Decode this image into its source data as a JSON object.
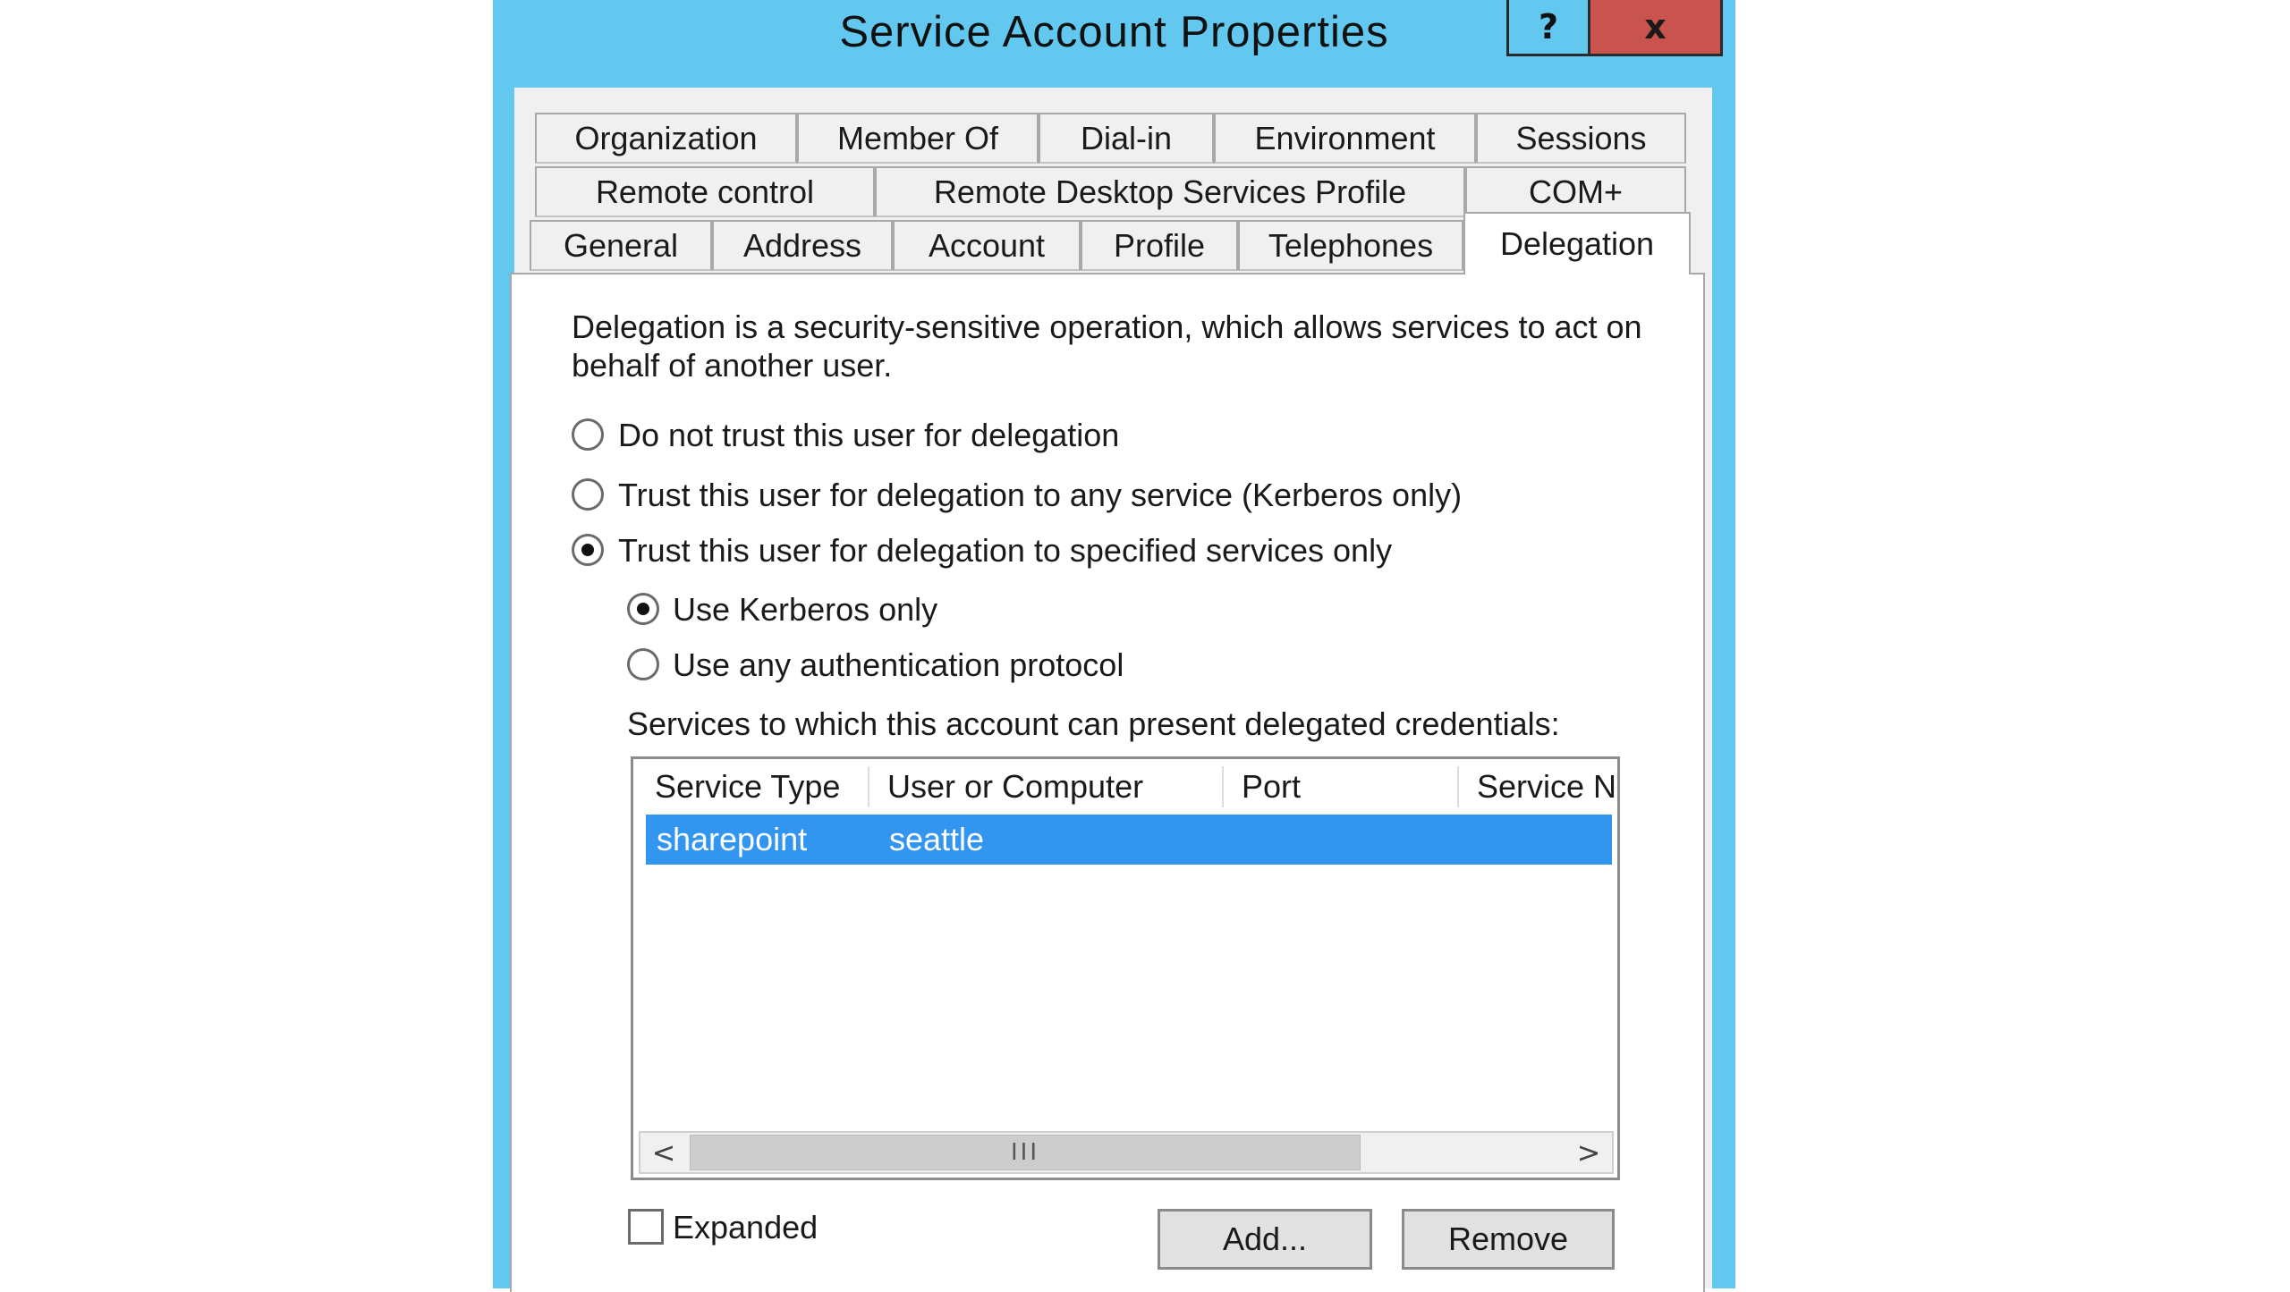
{
  "window": {
    "title": "Service Account Properties",
    "help_label": "?",
    "close_label": "x"
  },
  "tabs": {
    "row1": [
      "Organization",
      "Member Of",
      "Dial-in",
      "Environment",
      "Sessions"
    ],
    "row2": [
      "Remote control",
      "Remote Desktop Services Profile",
      "COM+"
    ],
    "row3": [
      "General",
      "Address",
      "Account",
      "Profile",
      "Telephones",
      "Delegation"
    ],
    "active": "Delegation"
  },
  "delegation": {
    "description_line1": "Delegation is a security-sensitive operation, which allows services to act on",
    "description_line2": "behalf of another user.",
    "options": [
      {
        "label": "Do not trust this user for delegation",
        "checked": false
      },
      {
        "label": "Trust this user for delegation to any service (Kerberos only)",
        "checked": false
      },
      {
        "label": "Trust this user for delegation to specified services only",
        "checked": true
      }
    ],
    "sub_options": [
      {
        "label": "Use Kerberos only",
        "checked": true
      },
      {
        "label": "Use any authentication protocol",
        "checked": false
      }
    ],
    "services_label": "Services to which this account can present delegated credentials:",
    "columns": [
      "Service Type",
      "User or Computer",
      "Port",
      "Service N"
    ],
    "rows": [
      {
        "service_type": "sharepoint",
        "user_or_computer": "seattle",
        "port": "",
        "service_name": "",
        "selected": true
      }
    ],
    "scroll_grip": "III",
    "scroll_left": "<",
    "scroll_right": ">",
    "expanded_label": "Expanded",
    "expanded_checked": false,
    "add_label": "Add...",
    "remove_label": "Remove"
  },
  "colors": {
    "title_bar": "#63c8ef",
    "close_button": "#c8534f",
    "selection": "#3296f0"
  }
}
